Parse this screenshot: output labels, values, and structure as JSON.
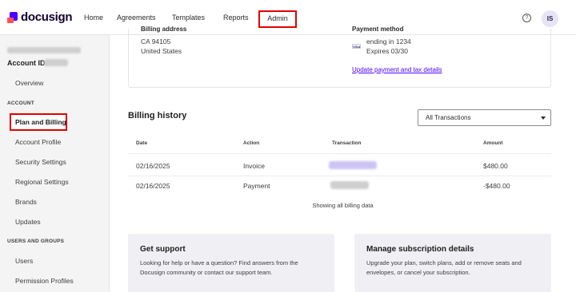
{
  "brand": {
    "name": "docusign",
    "accent": "#4c00ff",
    "highlight": "#e00000"
  },
  "nav": {
    "home": "Home",
    "agreements": "Agreements",
    "templates": "Templates",
    "reports": "Reports",
    "admin": "Admin",
    "help_icon": "?",
    "avatar": "IS"
  },
  "sidebar": {
    "account_id_label": "Account ID:",
    "overview": "Overview",
    "section_account": "ACCOUNT",
    "items": [
      "Plan and Billing",
      "Account Profile",
      "Security Settings",
      "Regional Settings",
      "Brands",
      "Updates"
    ],
    "section_users": "USERS AND GROUPS",
    "user_items": [
      "Users",
      "Permission Profiles"
    ]
  },
  "billing_address": {
    "label": "Billing address",
    "line1": "CA 94105",
    "line2": "United States"
  },
  "payment_method": {
    "label": "Payment method",
    "card_brand": "VISA",
    "card": "ending in 1234",
    "expires": "Expires 03/30",
    "update_link": "Update payment and tax details"
  },
  "billing_history": {
    "title": "Billing history",
    "filter": "All Transactions",
    "columns": [
      "Date",
      "Action",
      "Transaction",
      "Amount"
    ],
    "rows": [
      {
        "date": "02/16/2025",
        "action": "Invoice",
        "amount": "$480.00"
      },
      {
        "date": "02/16/2025",
        "action": "Payment",
        "amount": "-$480.00"
      }
    ],
    "footer": "Showing all billing data"
  },
  "support": {
    "title": "Get support",
    "text1": "Looking for help or have a question? Find answers from the",
    "text2": "Docusign community or contact our support team."
  },
  "subscription": {
    "title": "Manage subscription details",
    "text1": "Upgrade your plan, switch plans, add or remove seats and",
    "text2": "envelopes, or cancel your subscription."
  }
}
